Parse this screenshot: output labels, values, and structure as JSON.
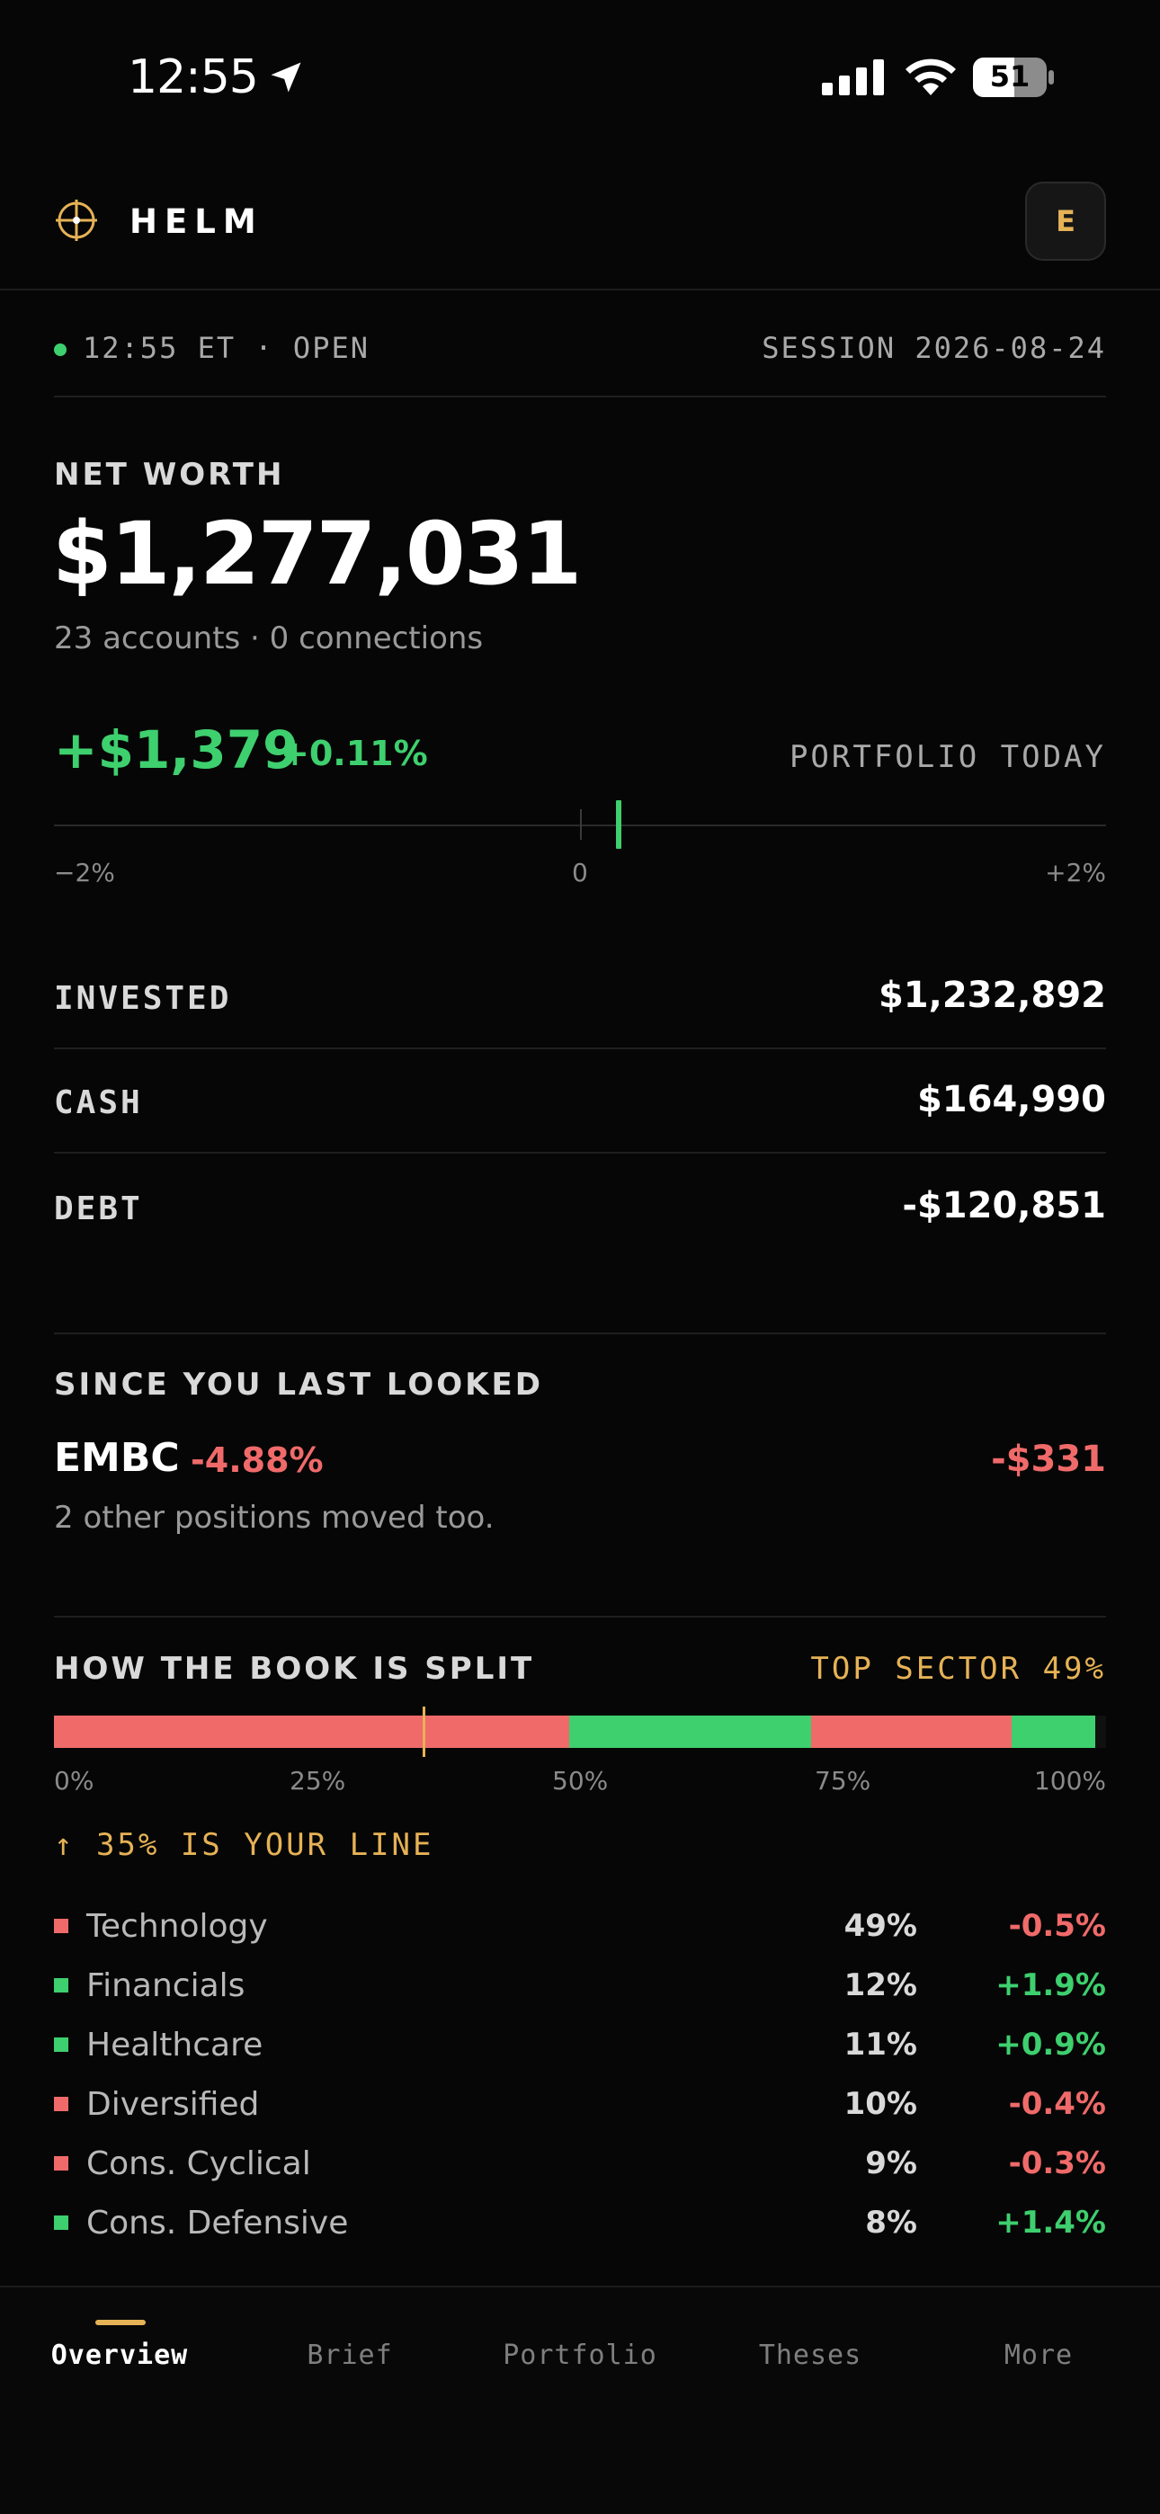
{
  "status_bar": {
    "time": "12:55",
    "battery": "51"
  },
  "header": {
    "brand": "HELM",
    "avatar_initial": "E"
  },
  "session": {
    "left": "12:55 ET · OPEN",
    "right": "SESSION 2026-08-24"
  },
  "net_worth": {
    "label": "NET WORTH",
    "value": "$1,277,031",
    "sub": "23 accounts · 0 connections"
  },
  "today": {
    "change": "+$1,379",
    "pct": "+0.11%",
    "label": "PORTFOLIO TODAY",
    "scale_min": "−2%",
    "scale_mid": "0",
    "scale_max": "+2%",
    "marker_pct": 0.11
  },
  "balances": [
    {
      "label": "INVESTED",
      "value": "$1,232,892"
    },
    {
      "label": "CASH",
      "value": "$164,990"
    },
    {
      "label": "DEBT",
      "value": "-$120,851"
    }
  ],
  "since": {
    "label": "SINCE YOU LAST LOOKED",
    "ticker": "EMBC",
    "pct": "-4.88%",
    "amount": "-$331",
    "sub": "2 other positions moved too."
  },
  "split": {
    "label": "HOW THE BOOK IS SPLIT",
    "top_sector": "TOP SECTOR 49%",
    "ticks": [
      "0%",
      "25%",
      "50%",
      "75%",
      "100%"
    ],
    "your_line": "↑ 35% IS YOUR LINE",
    "line_pct": 35,
    "segments": [
      {
        "pct": 49,
        "color": "#f06a6a"
      },
      {
        "pct": 23,
        "color": "#3ecf6e"
      },
      {
        "pct": 19,
        "color": "#f06a6a"
      },
      {
        "pct": 8,
        "color": "#3ecf6e"
      },
      {
        "pct": 1,
        "color": "#101010"
      }
    ],
    "sectors": [
      {
        "name": "Technology",
        "pct": "49%",
        "change": "-0.5%",
        "color": "#f06a6a"
      },
      {
        "name": "Financials",
        "pct": "12%",
        "change": "+1.9%",
        "color": "#3ecf6e"
      },
      {
        "name": "Healthcare",
        "pct": "11%",
        "change": "+0.9%",
        "color": "#3ecf6e"
      },
      {
        "name": "Diversified",
        "pct": "10%",
        "change": "-0.4%",
        "color": "#f06a6a"
      },
      {
        "name": "Cons. Cyclical",
        "pct": "9%",
        "change": "-0.3%",
        "color": "#f06a6a"
      },
      {
        "name": "Cons. Defensive",
        "pct": "8%",
        "change": "+1.4%",
        "color": "#3ecf6e"
      }
    ]
  },
  "tabs": [
    {
      "label": "Overview",
      "active": true
    },
    {
      "label": "Brief",
      "active": false
    },
    {
      "label": "Portfolio",
      "active": false
    },
    {
      "label": "Theses",
      "active": false
    },
    {
      "label": "More",
      "active": false
    }
  ],
  "colors": {
    "positive": "#3ecf6e",
    "negative": "#f06a6a",
    "accent": "#e6b256"
  }
}
